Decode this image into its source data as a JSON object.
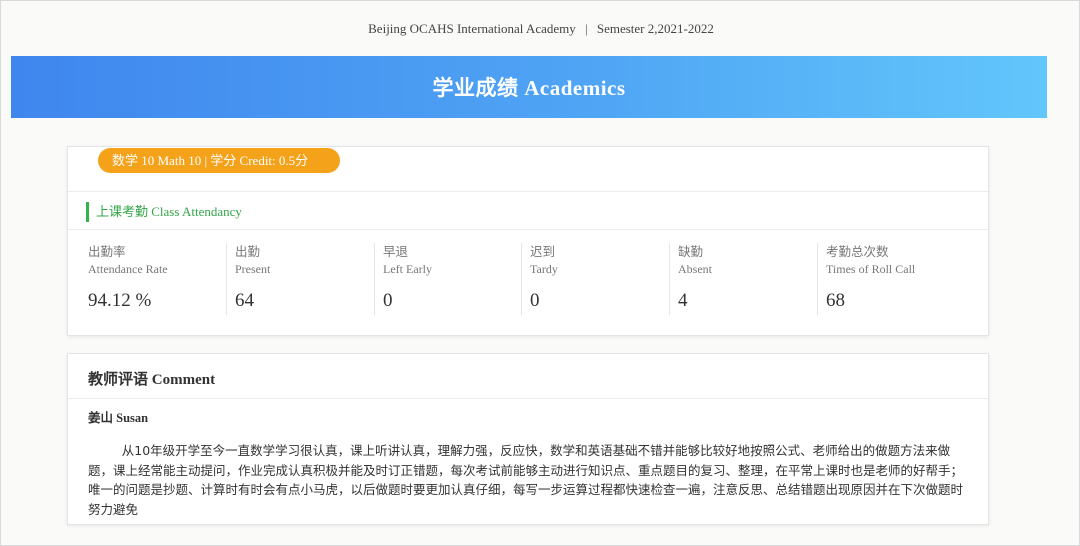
{
  "header": {
    "school": "Beijing OCAHS International Academy",
    "separator": "|",
    "semester": "Semester 2,2021-2022"
  },
  "banner": {
    "title": "学业成绩 Academics"
  },
  "course": {
    "label": "数学 10 Math 10 | 学分 Credit: 0.5分"
  },
  "attendance": {
    "section_title": "上课考勤 Class Attendancy",
    "stats": [
      {
        "zh": "出勤率",
        "en": "Attendance Rate",
        "value": "94.12 %"
      },
      {
        "zh": "出勤",
        "en": "Present",
        "value": "64"
      },
      {
        "zh": "早退",
        "en": "Left Early",
        "value": "0"
      },
      {
        "zh": "迟到",
        "en": "Tardy",
        "value": "0"
      },
      {
        "zh": "缺勤",
        "en": "Absent",
        "value": "4"
      },
      {
        "zh": "考勤总次数",
        "en": "Times of Roll Call",
        "value": "68"
      }
    ]
  },
  "comment": {
    "title": "教师评语 Comment",
    "teacher": "姜山 Susan",
    "body": "从10年级开学至今一直数学学习很认真，课上听讲认真，理解力强，反应快，数学和英语基础不错并能够比较好地按照公式、老师给出的做题方法来做题，课上经常能主动提问，作业完成认真积极并能及时订正错题，每次考试前能够主动进行知识点、重点题目的复习、整理，在平常上课时也是老师的好帮手；唯一的问题是抄题、计算时有时会有点小马虎，以后做题时要更加认真仔细，每写一步运算过程都快速检查一遍，注意反思、总结错题出现原因并在下次做题时努力避免"
  },
  "colors": {
    "banner_start": "#3f86ee",
    "banner_end": "#62c6fb",
    "course_pill": "#f5a21b",
    "attendance_accent": "#33b34a"
  }
}
